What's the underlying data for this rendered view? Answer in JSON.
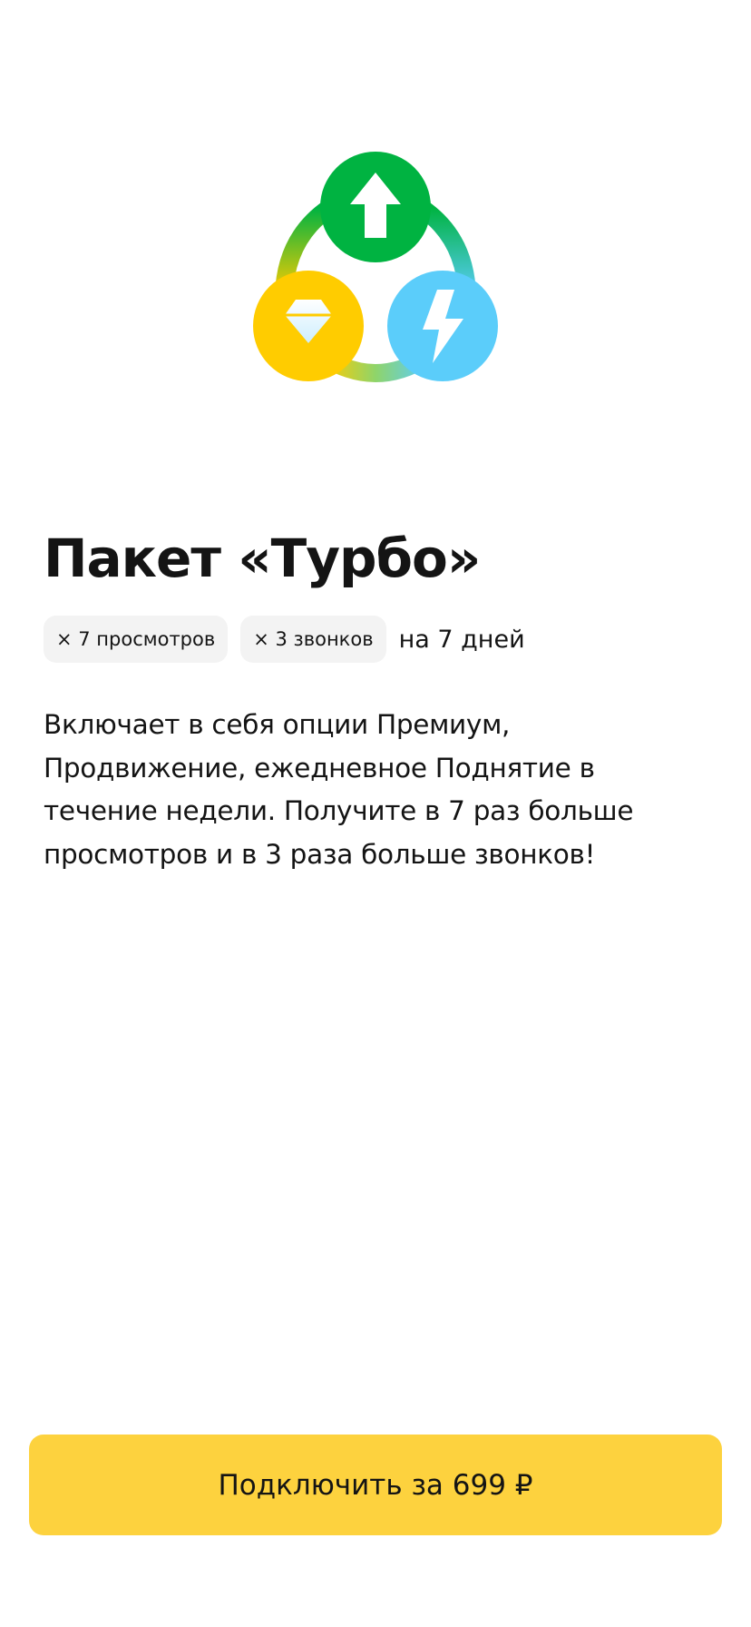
{
  "logo": {
    "icon": "turbo-package-logo",
    "colors": {
      "green": "#00b341",
      "yellow": "#ffcc00",
      "blue": "#5bcdfa"
    }
  },
  "package": {
    "title": "Пакет «Турбо»",
    "badges": [
      {
        "label": "× 7 просмотров"
      },
      {
        "label": "× 3 звонков"
      }
    ],
    "duration": "на 7 дней",
    "description": "Включает в себя опции Премиум, Продвижение, ежедневное Поднятие в течение недели. Получите в 7 раз больше просмотров и в 3 раза больше звонков!"
  },
  "cta": {
    "label": "Подключить за 699 ₽",
    "color": "#fdd23e"
  }
}
